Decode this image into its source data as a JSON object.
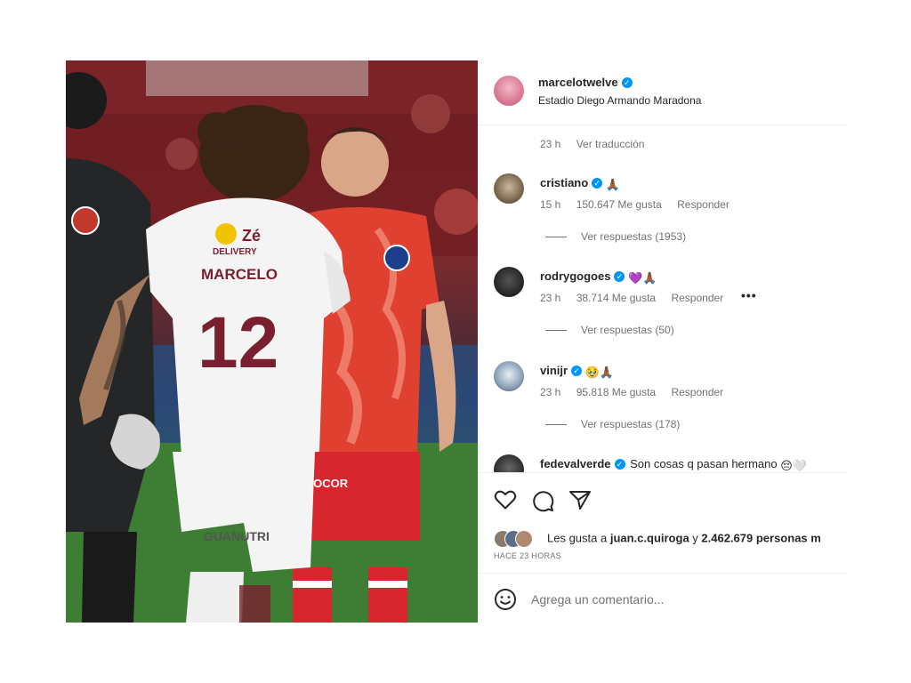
{
  "photo": {
    "left_player_name": "MARCELO",
    "left_player_number": "12",
    "sponsor_top": "Zé",
    "sponsor_bottom": "DELIVERY",
    "shorts_text": "GUANUTRI",
    "right_shorts_text": "NGIOCOR"
  },
  "post": {
    "author": "marcelotwelve",
    "location": "Estadio Diego Armando Maradona",
    "caption_time": "23 h",
    "caption_translate": "Ver traducción"
  },
  "comments": [
    {
      "user": "cristiano",
      "text": "",
      "emoji": "🙏🏾",
      "time": "15 h",
      "likes": "150.647 Me gusta",
      "reply": "Responder",
      "replies": "Ver respuestas (1953)"
    },
    {
      "user": "rodrygogoes",
      "text": "",
      "emoji": "💜🙏🏾",
      "time": "23 h",
      "likes": "38.714 Me gusta",
      "reply": "Responder",
      "more": "•••",
      "replies": "Ver respuestas (50)"
    },
    {
      "user": "vinijr",
      "text": "",
      "emoji": "🥹🙏🏾",
      "time": "23 h",
      "likes": "95.818 Me gusta",
      "reply": "Responder",
      "replies": "Ver respuestas (178)"
    },
    {
      "user": "fedevalverde",
      "text": "Son cosas q pasan hermano",
      "emoji": "😔🤍"
    }
  ],
  "actions": {
    "icons": [
      "heart-icon",
      "comment-icon",
      "share-icon"
    ],
    "likes_prefix": "Les gusta a ",
    "likes_user": "juan.c.quiroga",
    "likes_middle": " y ",
    "likes_count": "2.462.679 personas m",
    "time_ago": "HACE 23 HORAS",
    "comment_placeholder": "Agrega un comentario..."
  },
  "colors": {
    "verified": "#0095f6",
    "muted_text": "#737373",
    "argentinos_red": "#e0402f",
    "fluminense_maroon": "#7a1f2f"
  }
}
